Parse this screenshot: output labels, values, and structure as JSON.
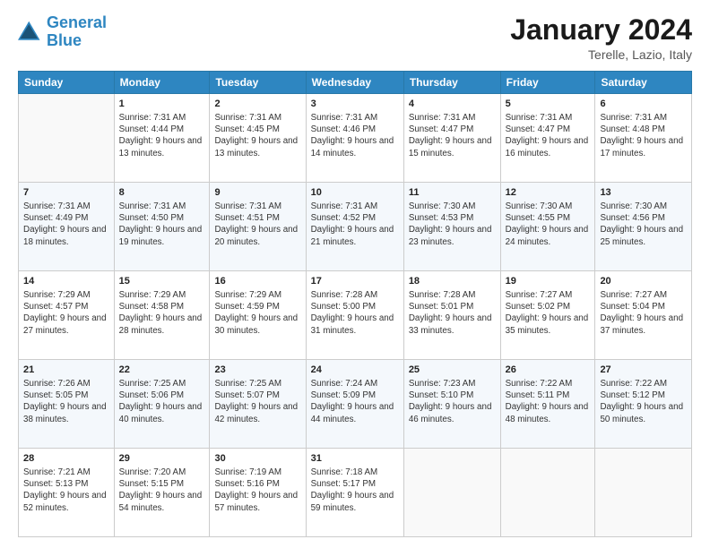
{
  "header": {
    "logo_line1": "General",
    "logo_line2": "Blue",
    "month_year": "January 2024",
    "location": "Terelle, Lazio, Italy"
  },
  "days_of_week": [
    "Sunday",
    "Monday",
    "Tuesday",
    "Wednesday",
    "Thursday",
    "Friday",
    "Saturday"
  ],
  "weeks": [
    [
      {
        "day": "",
        "sunrise": "",
        "sunset": "",
        "daylight": ""
      },
      {
        "day": "1",
        "sunrise": "7:31 AM",
        "sunset": "4:44 PM",
        "daylight": "9 hours and 13 minutes."
      },
      {
        "day": "2",
        "sunrise": "7:31 AM",
        "sunset": "4:45 PM",
        "daylight": "9 hours and 13 minutes."
      },
      {
        "day": "3",
        "sunrise": "7:31 AM",
        "sunset": "4:46 PM",
        "daylight": "9 hours and 14 minutes."
      },
      {
        "day": "4",
        "sunrise": "7:31 AM",
        "sunset": "4:47 PM",
        "daylight": "9 hours and 15 minutes."
      },
      {
        "day": "5",
        "sunrise": "7:31 AM",
        "sunset": "4:47 PM",
        "daylight": "9 hours and 16 minutes."
      },
      {
        "day": "6",
        "sunrise": "7:31 AM",
        "sunset": "4:48 PM",
        "daylight": "9 hours and 17 minutes."
      }
    ],
    [
      {
        "day": "7",
        "sunrise": "7:31 AM",
        "sunset": "4:49 PM",
        "daylight": "9 hours and 18 minutes."
      },
      {
        "day": "8",
        "sunrise": "7:31 AM",
        "sunset": "4:50 PM",
        "daylight": "9 hours and 19 minutes."
      },
      {
        "day": "9",
        "sunrise": "7:31 AM",
        "sunset": "4:51 PM",
        "daylight": "9 hours and 20 minutes."
      },
      {
        "day": "10",
        "sunrise": "7:31 AM",
        "sunset": "4:52 PM",
        "daylight": "9 hours and 21 minutes."
      },
      {
        "day": "11",
        "sunrise": "7:30 AM",
        "sunset": "4:53 PM",
        "daylight": "9 hours and 23 minutes."
      },
      {
        "day": "12",
        "sunrise": "7:30 AM",
        "sunset": "4:55 PM",
        "daylight": "9 hours and 24 minutes."
      },
      {
        "day": "13",
        "sunrise": "7:30 AM",
        "sunset": "4:56 PM",
        "daylight": "9 hours and 25 minutes."
      }
    ],
    [
      {
        "day": "14",
        "sunrise": "7:29 AM",
        "sunset": "4:57 PM",
        "daylight": "9 hours and 27 minutes."
      },
      {
        "day": "15",
        "sunrise": "7:29 AM",
        "sunset": "4:58 PM",
        "daylight": "9 hours and 28 minutes."
      },
      {
        "day": "16",
        "sunrise": "7:29 AM",
        "sunset": "4:59 PM",
        "daylight": "9 hours and 30 minutes."
      },
      {
        "day": "17",
        "sunrise": "7:28 AM",
        "sunset": "5:00 PM",
        "daylight": "9 hours and 31 minutes."
      },
      {
        "day": "18",
        "sunrise": "7:28 AM",
        "sunset": "5:01 PM",
        "daylight": "9 hours and 33 minutes."
      },
      {
        "day": "19",
        "sunrise": "7:27 AM",
        "sunset": "5:02 PM",
        "daylight": "9 hours and 35 minutes."
      },
      {
        "day": "20",
        "sunrise": "7:27 AM",
        "sunset": "5:04 PM",
        "daylight": "9 hours and 37 minutes."
      }
    ],
    [
      {
        "day": "21",
        "sunrise": "7:26 AM",
        "sunset": "5:05 PM",
        "daylight": "9 hours and 38 minutes."
      },
      {
        "day": "22",
        "sunrise": "7:25 AM",
        "sunset": "5:06 PM",
        "daylight": "9 hours and 40 minutes."
      },
      {
        "day": "23",
        "sunrise": "7:25 AM",
        "sunset": "5:07 PM",
        "daylight": "9 hours and 42 minutes."
      },
      {
        "day": "24",
        "sunrise": "7:24 AM",
        "sunset": "5:09 PM",
        "daylight": "9 hours and 44 minutes."
      },
      {
        "day": "25",
        "sunrise": "7:23 AM",
        "sunset": "5:10 PM",
        "daylight": "9 hours and 46 minutes."
      },
      {
        "day": "26",
        "sunrise": "7:22 AM",
        "sunset": "5:11 PM",
        "daylight": "9 hours and 48 minutes."
      },
      {
        "day": "27",
        "sunrise": "7:22 AM",
        "sunset": "5:12 PM",
        "daylight": "9 hours and 50 minutes."
      }
    ],
    [
      {
        "day": "28",
        "sunrise": "7:21 AM",
        "sunset": "5:13 PM",
        "daylight": "9 hours and 52 minutes."
      },
      {
        "day": "29",
        "sunrise": "7:20 AM",
        "sunset": "5:15 PM",
        "daylight": "9 hours and 54 minutes."
      },
      {
        "day": "30",
        "sunrise": "7:19 AM",
        "sunset": "5:16 PM",
        "daylight": "9 hours and 57 minutes."
      },
      {
        "day": "31",
        "sunrise": "7:18 AM",
        "sunset": "5:17 PM",
        "daylight": "9 hours and 59 minutes."
      },
      {
        "day": "",
        "sunrise": "",
        "sunset": "",
        "daylight": ""
      },
      {
        "day": "",
        "sunrise": "",
        "sunset": "",
        "daylight": ""
      },
      {
        "day": "",
        "sunrise": "",
        "sunset": "",
        "daylight": ""
      }
    ]
  ],
  "labels": {
    "sunrise_prefix": "Sunrise: ",
    "sunset_prefix": "Sunset: ",
    "daylight_prefix": "Daylight: "
  }
}
